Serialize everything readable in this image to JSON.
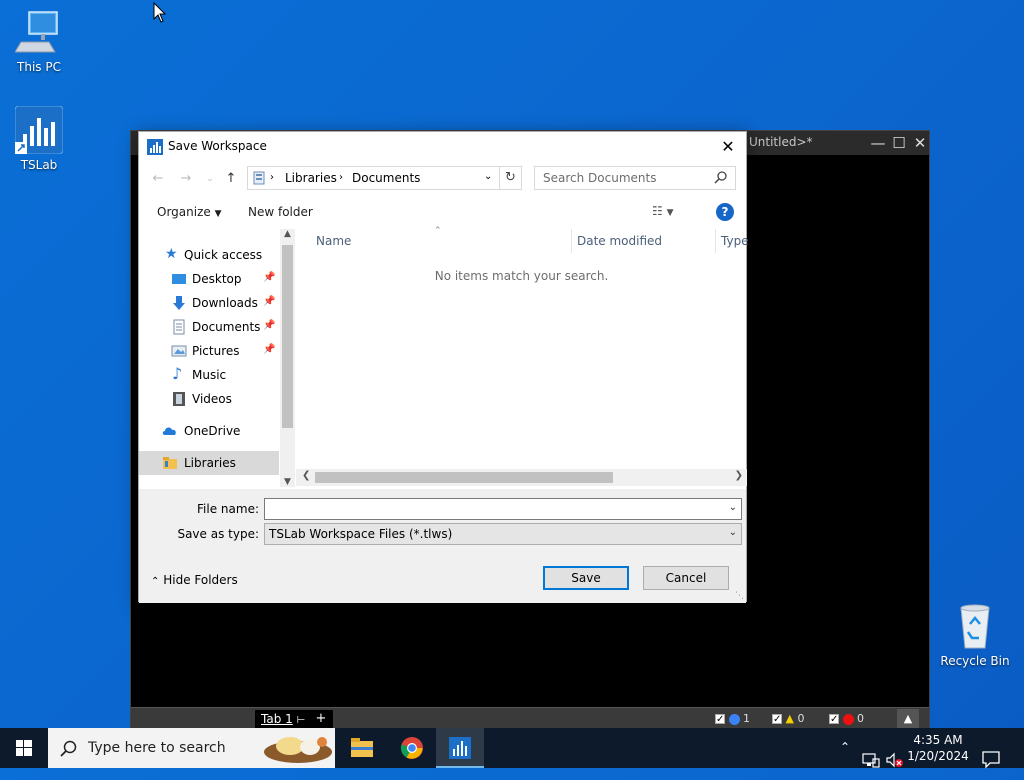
{
  "desktop": {
    "icons": [
      {
        "label": "This PC"
      },
      {
        "label": "TSLab"
      },
      {
        "label": "Recycle Bin"
      }
    ]
  },
  "tslab_window": {
    "title_fragment": "Untitled>*",
    "tab_label": "Tab 1",
    "add_tab": "+",
    "indicators": {
      "info": "1",
      "warning": "0",
      "error": "0"
    }
  },
  "dialog": {
    "title": "Save Workspace",
    "address": {
      "root": "Libraries",
      "current": "Documents"
    },
    "search_placeholder": "Search Documents",
    "toolbar": {
      "organize": "Organize",
      "new_folder": "New folder"
    },
    "nav": {
      "quick_access": "Quick access",
      "items": [
        "Desktop",
        "Downloads",
        "Documents",
        "Pictures",
        "Music",
        "Videos"
      ],
      "onedrive": "OneDrive",
      "libraries": "Libraries"
    },
    "columns": [
      "Name",
      "Date modified",
      "Type"
    ],
    "empty_message": "No items match your search.",
    "file_name_label": "File name:",
    "file_name_value": "",
    "save_type_label": "Save as type:",
    "save_type_value": "TSLab Workspace Files (*.tlws)",
    "hide_folders": "Hide Folders",
    "save_button": "Save",
    "cancel_button": "Cancel"
  },
  "taskbar": {
    "search_placeholder": "Type here to search",
    "time": "4:35 AM",
    "date": "1/20/2024"
  },
  "colors": {
    "accent": "#0078d7",
    "desktop": "#0a64cc",
    "taskbar": "#0d1a2c"
  }
}
